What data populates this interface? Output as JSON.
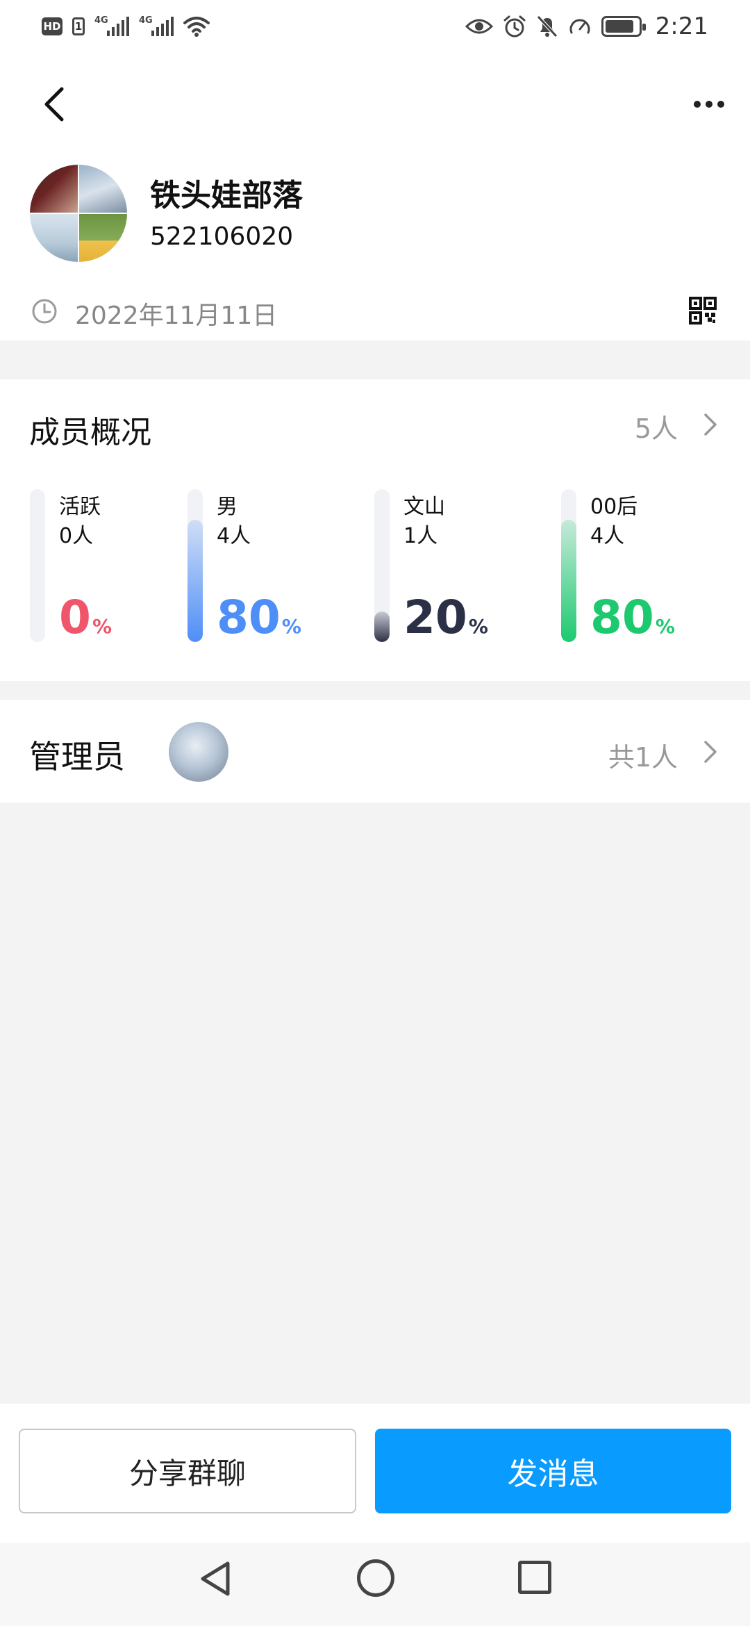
{
  "status_bar": {
    "time": "2:21",
    "hd_label": "HD",
    "sim_label": "1",
    "network_1": "4G",
    "network_2": "4G"
  },
  "header": {
    "group_name": "铁头娃部落",
    "group_id": "522106020",
    "created_date": "2022年11月11日"
  },
  "members": {
    "title": "成员概况",
    "total": "5人",
    "stats": [
      {
        "label": "活跃",
        "count": "0人",
        "percent": "0",
        "unit": "%",
        "fraction": 0.0,
        "color": "#f0566b"
      },
      {
        "label": "男",
        "count": "4人",
        "percent": "80",
        "unit": "%",
        "fraction": 0.8,
        "color": "#4e8ef7"
      },
      {
        "label": "文山",
        "count": "1人",
        "percent": "20",
        "unit": "%",
        "fraction": 0.2,
        "color": "#2b3047"
      },
      {
        "label": "00后",
        "count": "4人",
        "percent": "80",
        "unit": "%",
        "fraction": 0.8,
        "color": "#1dc96f"
      }
    ]
  },
  "admins": {
    "title": "管理员",
    "count": "共1人"
  },
  "actions": {
    "share_label": "分享群聊",
    "send_label": "发消息"
  },
  "colors": {
    "accent": "#0a9bff",
    "background": "#f3f3f4",
    "muted_text": "#999999"
  }
}
